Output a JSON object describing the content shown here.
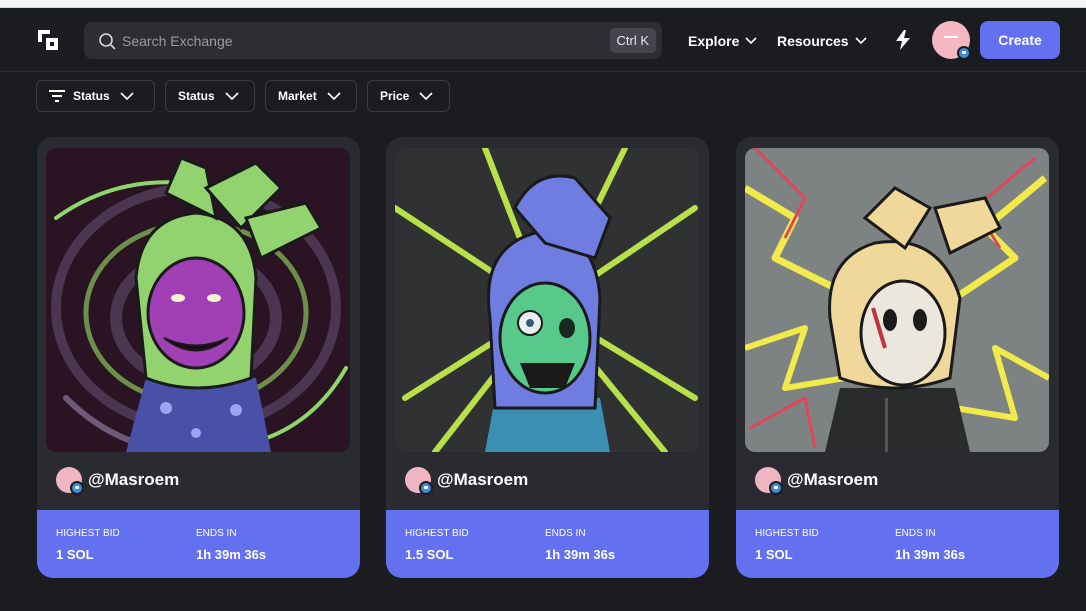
{
  "search": {
    "placeholder": "Search Exchange",
    "shortcut": "Ctrl K"
  },
  "nav": {
    "explore": "Explore",
    "resources": "Resources",
    "create": "Create"
  },
  "filters": [
    "Status",
    "Status",
    "Market",
    "Price"
  ],
  "cards": [
    {
      "owner": "@Masroem",
      "highest_bid_label": "HIGHEST BID",
      "highest_bid": "1 SOL",
      "ends_in_label": "ENDS IN",
      "ends_in": "1h 39m 36s"
    },
    {
      "owner": "@Masroem",
      "highest_bid_label": "HIGHEST BID",
      "highest_bid": "1.5 SOL",
      "ends_in_label": "ENDS IN",
      "ends_in": "1h 39m 36s"
    },
    {
      "owner": "@Masroem",
      "highest_bid_label": "HIGHEST BID",
      "highest_bid": "1 SOL",
      "ends_in_label": "ENDS IN",
      "ends_in": "1h 39m 36s"
    }
  ],
  "icons": {
    "logo": "logo-icon",
    "search": "search-icon",
    "bolt": "lightning-icon",
    "verified": "verified-badge-icon",
    "filter": "filter-lines-icon",
    "chevron": "chevron-down-icon"
  },
  "colors": {
    "background": "#1b1c20",
    "card": "#2a2b30",
    "accent": "#6370ef",
    "avatar": "#f5b7c2"
  }
}
